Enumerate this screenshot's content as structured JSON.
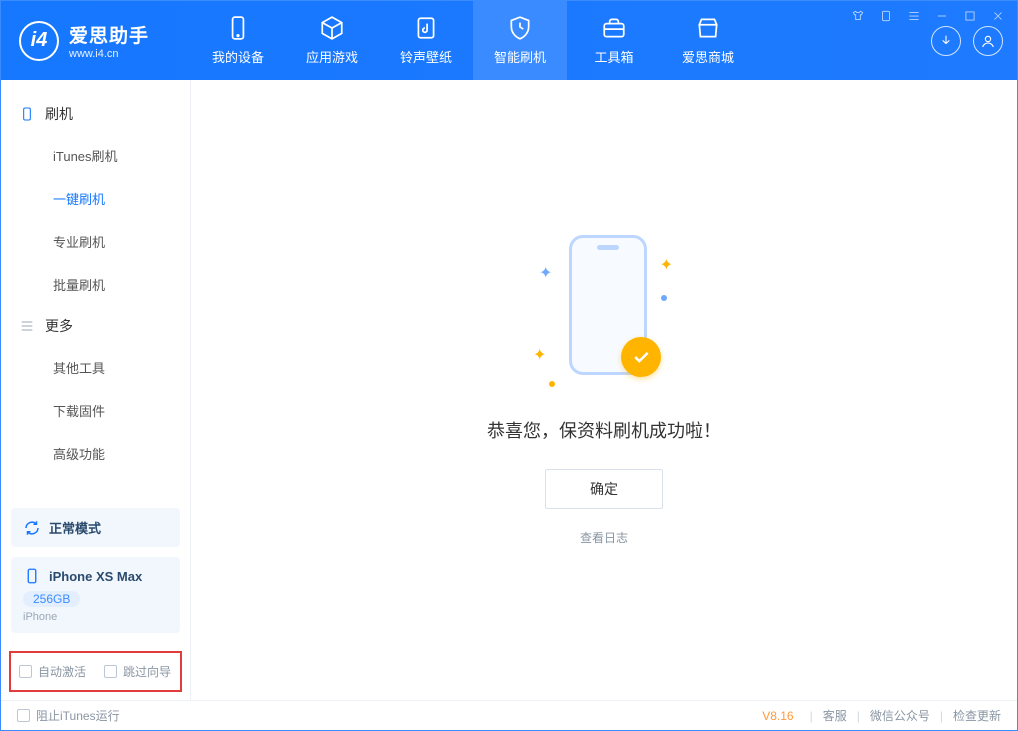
{
  "app": {
    "name_cn": "爱思助手",
    "name_en": "www.i4.cn"
  },
  "nav": {
    "items": [
      {
        "label": "我的设备",
        "icon": "phone"
      },
      {
        "label": "应用游戏",
        "icon": "cube"
      },
      {
        "label": "铃声壁纸",
        "icon": "music"
      },
      {
        "label": "智能刷机",
        "icon": "shield",
        "active": true
      },
      {
        "label": "工具箱",
        "icon": "toolbox"
      },
      {
        "label": "爱思商城",
        "icon": "store"
      }
    ]
  },
  "sidebar": {
    "groups": [
      {
        "title": "刷机",
        "items": [
          "iTunes刷机",
          "一键刷机",
          "专业刷机",
          "批量刷机"
        ],
        "active_index": 1
      },
      {
        "title": "更多",
        "items": [
          "其他工具",
          "下载固件",
          "高级功能"
        ],
        "active_index": -1
      }
    ],
    "mode_card": {
      "label": "正常模式"
    },
    "device_card": {
      "name": "iPhone XS Max",
      "storage": "256GB",
      "type": "iPhone"
    },
    "checkboxes": {
      "auto_activate": "自动激活",
      "skip_guide": "跳过向导"
    }
  },
  "main": {
    "success_text": "恭喜您，保资料刷机成功啦！",
    "ok_button": "确定",
    "view_log": "查看日志"
  },
  "footer": {
    "block_itunes": "阻止iTunes运行",
    "version": "V8.16",
    "links": [
      "客服",
      "微信公众号",
      "检查更新"
    ]
  }
}
